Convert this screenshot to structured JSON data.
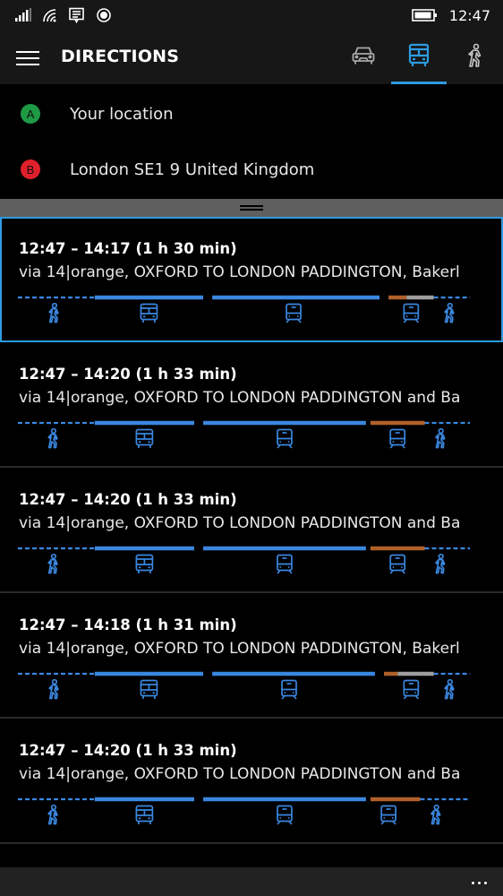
{
  "status_bar": {
    "time": "12:47",
    "icons": [
      "signal-strength-icon",
      "wifi-icon",
      "message-notification-icon",
      "location-icon",
      "battery-icon"
    ]
  },
  "app_bar": {
    "title": "DIRECTIONS",
    "menu_icon": "hamburger-menu-icon",
    "modes": [
      {
        "name": "car",
        "icon": "car-icon",
        "active": false
      },
      {
        "name": "transit",
        "icon": "bus-icon",
        "active": true
      },
      {
        "name": "walk",
        "icon": "walking-person-icon",
        "active": false
      }
    ]
  },
  "waypoints": [
    {
      "badge": "A",
      "text": "Your location",
      "color": "#1e9a45"
    },
    {
      "badge": "B",
      "text": "London SE1 9 United Kingdom",
      "color": "#e0202b"
    }
  ],
  "colors": {
    "accent": "#2d9be1",
    "transit_blue": "#3a87e0",
    "bakerloo_brown": "#b0602a",
    "grey_segment": "#9e9e9e"
  },
  "routes": [
    {
      "time": "12:47 – 14:17 (1 h 30 min)",
      "via": "via 14|orange, OXFORD TO LONDON PADDINGTON, Bakerl",
      "selected": true,
      "segments": [
        {
          "mode": "walk",
          "from": 0.0,
          "to": 0.17
        },
        {
          "mode": "bus",
          "from": 0.17,
          "to": 0.41
        },
        {
          "mode": "rail",
          "from": 0.43,
          "to": 0.8
        },
        {
          "mode": "tube",
          "from": 0.82,
          "to": 0.86,
          "color": "brown"
        },
        {
          "mode": "tube",
          "from": 0.86,
          "to": 0.92,
          "color": "grey"
        },
        {
          "mode": "walk",
          "from": 0.92,
          "to": 1.0
        }
      ],
      "icons": [
        {
          "type": "walk",
          "at": 0.085
        },
        {
          "type": "bus",
          "at": 0.29
        },
        {
          "type": "train",
          "at": 0.61
        },
        {
          "type": "train",
          "at": 0.87
        },
        {
          "type": "walk",
          "at": 0.96
        }
      ]
    },
    {
      "time": "12:47 – 14:20 (1 h 33 min)",
      "via": "via 14|orange, OXFORD TO LONDON PADDINGTON and Ba",
      "selected": false,
      "segments": [
        {
          "mode": "walk",
          "from": 0.0,
          "to": 0.17
        },
        {
          "mode": "bus",
          "from": 0.17,
          "to": 0.39
        },
        {
          "mode": "rail",
          "from": 0.41,
          "to": 0.77
        },
        {
          "mode": "tube",
          "from": 0.78,
          "to": 0.9,
          "color": "brown"
        },
        {
          "mode": "walk",
          "from": 0.9,
          "to": 1.0
        }
      ],
      "icons": [
        {
          "type": "walk",
          "at": 0.083
        },
        {
          "type": "bus",
          "at": 0.28
        },
        {
          "type": "train",
          "at": 0.59
        },
        {
          "type": "train",
          "at": 0.84
        },
        {
          "type": "walk",
          "at": 0.94
        }
      ]
    },
    {
      "time": "12:47 – 14:20 (1 h 33 min)",
      "via": "via 14|orange, OXFORD TO LONDON PADDINGTON and Ba",
      "selected": false,
      "segments": [
        {
          "mode": "walk",
          "from": 0.0,
          "to": 0.17
        },
        {
          "mode": "bus",
          "from": 0.17,
          "to": 0.39
        },
        {
          "mode": "rail",
          "from": 0.41,
          "to": 0.77
        },
        {
          "mode": "tube",
          "from": 0.78,
          "to": 0.9,
          "color": "brown"
        },
        {
          "mode": "walk",
          "from": 0.9,
          "to": 1.0
        }
      ],
      "icons": [
        {
          "type": "walk",
          "at": 0.083
        },
        {
          "type": "bus",
          "at": 0.28
        },
        {
          "type": "train",
          "at": 0.59
        },
        {
          "type": "train",
          "at": 0.84
        },
        {
          "type": "walk",
          "at": 0.94
        }
      ]
    },
    {
      "time": "12:47 – 14:18 (1 h 31 min)",
      "via": "via 14|orange, OXFORD TO LONDON PADDINGTON, Bakerl",
      "selected": false,
      "segments": [
        {
          "mode": "walk",
          "from": 0.0,
          "to": 0.17
        },
        {
          "mode": "bus",
          "from": 0.17,
          "to": 0.41
        },
        {
          "mode": "rail",
          "from": 0.43,
          "to": 0.79
        },
        {
          "mode": "tube",
          "from": 0.81,
          "to": 0.84,
          "color": "brown"
        },
        {
          "mode": "tube",
          "from": 0.84,
          "to": 0.92,
          "color": "grey"
        },
        {
          "mode": "walk",
          "from": 0.92,
          "to": 1.0
        }
      ],
      "icons": [
        {
          "type": "walk",
          "at": 0.085
        },
        {
          "type": "bus",
          "at": 0.29
        },
        {
          "type": "train",
          "at": 0.6
        },
        {
          "type": "train",
          "at": 0.87
        },
        {
          "type": "walk",
          "at": 0.96
        }
      ]
    },
    {
      "time": "12:47 – 14:20 (1 h 33 min)",
      "via": "via 14|orange, OXFORD TO LONDON PADDINGTON and Ba",
      "selected": false,
      "segments": [
        {
          "mode": "walk",
          "from": 0.0,
          "to": 0.17
        },
        {
          "mode": "bus",
          "from": 0.17,
          "to": 0.39
        },
        {
          "mode": "rail",
          "from": 0.41,
          "to": 0.77
        },
        {
          "mode": "tube",
          "from": 0.78,
          "to": 0.89,
          "color": "brown"
        },
        {
          "mode": "walk",
          "from": 0.89,
          "to": 1.0
        }
      ],
      "icons": [
        {
          "type": "walk",
          "at": 0.083
        },
        {
          "type": "bus",
          "at": 0.28
        },
        {
          "type": "train",
          "at": 0.59
        },
        {
          "type": "train",
          "at": 0.82
        },
        {
          "type": "walk",
          "at": 0.93
        }
      ]
    }
  ],
  "bottom_bar": {
    "more_icon": "more-options-icon"
  }
}
